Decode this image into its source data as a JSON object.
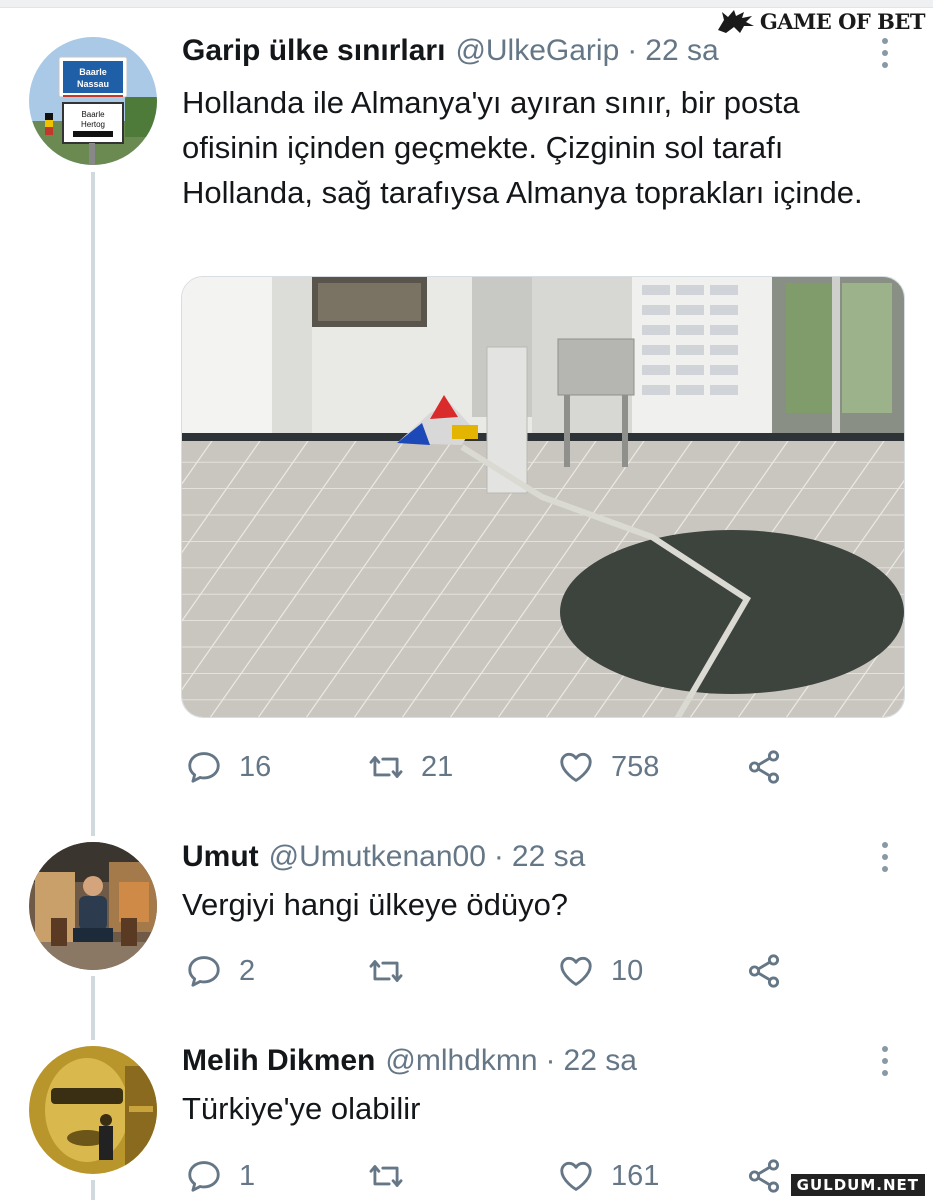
{
  "watermarks": {
    "top_brand": "GAME OF BET",
    "bottom_brand": "GULDUM.NET"
  },
  "colors": {
    "text_primary": "#14171a",
    "text_secondary": "#657786",
    "thread_line": "#cfd9de"
  },
  "tweets": [
    {
      "name": "Garip ülke sınırları",
      "handle": "@UlkeGarip",
      "separator": "·",
      "time": "22 sa",
      "text": "Hollanda ile Almanya'yı ayıran sınır, bir posta ofisinin içinden geçmekte. Çizginin sol tarafı Hollanda, sağ tarafıysa Almanya toprakları içinde.",
      "avatar_sign": {
        "top": "Baarle Nassau",
        "bottom": "Baarle Hertog"
      },
      "actions": {
        "replies": "16",
        "retweets": "21",
        "likes": "758"
      },
      "icons": [
        "reply-icon",
        "retweet-icon",
        "like-icon",
        "share-icon",
        "more-options-icon"
      ]
    },
    {
      "name": "Umut",
      "handle": "@Umutkenan00",
      "separator": "·",
      "time": "22 sa",
      "text": "Vergiyi hangi ülkeye ödüyo?",
      "actions": {
        "replies": "2",
        "retweets": "",
        "likes": "10"
      },
      "icons": [
        "reply-icon",
        "retweet-icon",
        "like-icon",
        "share-icon",
        "more-options-icon"
      ]
    },
    {
      "name": "Melih Dikmen",
      "handle": "@mlhdkmn",
      "separator": "·",
      "time": "22 sa",
      "text": "Türkiye'ye olabilir",
      "actions": {
        "replies": "1",
        "retweets": "",
        "likes": "161"
      },
      "icons": [
        "reply-icon",
        "retweet-icon",
        "like-icon",
        "share-icon",
        "more-options-icon"
      ]
    }
  ]
}
